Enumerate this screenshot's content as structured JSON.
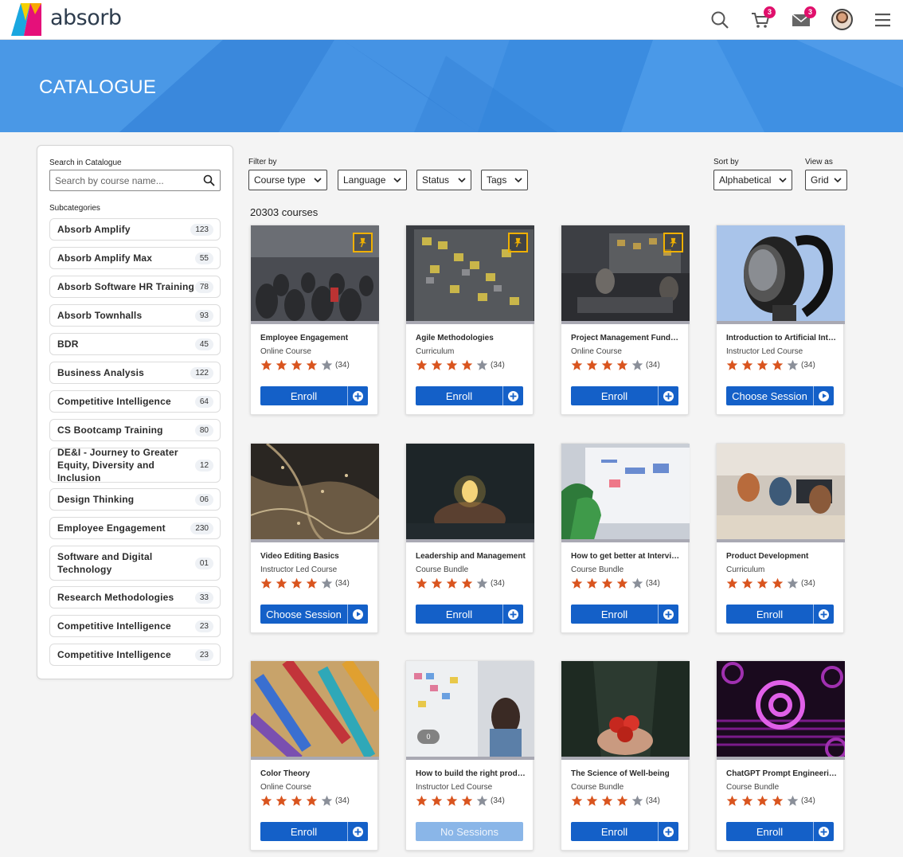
{
  "app": {
    "logo_text": "absorb"
  },
  "header": {
    "cart_badge": "3",
    "messages_badge": "3",
    "icons": [
      "search-icon",
      "cart-icon",
      "mail-icon",
      "avatar",
      "menu-icon"
    ]
  },
  "banner": {
    "title": "CATALOGUE",
    "color": "#3d8fe2"
  },
  "sidebar": {
    "search_label": "Search in Catalogue",
    "search_placeholder": "Search by course name...",
    "subcategories_label": "Subcategories",
    "items": [
      {
        "name": "Absorb Amplify",
        "count": "123"
      },
      {
        "name": "Absorb Amplify Max",
        "count": "55"
      },
      {
        "name": "Absorb Software HR Training",
        "count": "78"
      },
      {
        "name": "Absorb Townhalls",
        "count": "93"
      },
      {
        "name": "BDR",
        "count": "45"
      },
      {
        "name": "Business Analysis",
        "count": "122"
      },
      {
        "name": "Competitive Intelligence",
        "count": "64"
      },
      {
        "name": "CS Bootcamp Training",
        "count": "80"
      },
      {
        "name": "DE&I - Journey to Greater Equity, Diversity and Inclusion",
        "count": "12"
      },
      {
        "name": "Design Thinking",
        "count": "06"
      },
      {
        "name": "Employee Engagement",
        "count": "230"
      },
      {
        "name": "Software and Digital Technology",
        "count": "01"
      },
      {
        "name": "Research Methodologies",
        "count": "33"
      },
      {
        "name": "Competitive Intelligence",
        "count": "23"
      },
      {
        "name": "Competitive Intelligence",
        "count": "23"
      }
    ]
  },
  "filters": {
    "filter_by_label": "Filter by",
    "course_type": "Course type",
    "language": "Language",
    "status": "Status",
    "tags": "Tags",
    "sort_by_label": "Sort by",
    "sort_value": "Alphabetical",
    "view_as_label": "View as",
    "view_value": "Grid"
  },
  "results": {
    "count_text": "20303 courses"
  },
  "cards": [
    {
      "title": "Employee Engagement",
      "type": "Online Course",
      "rating": 4,
      "reviews": "(34)",
      "action": "Enroll",
      "pinned": true
    },
    {
      "title": "Agile Methodologies",
      "type": "Curriculum",
      "rating": 4,
      "reviews": "(34)",
      "action": "Enroll",
      "pinned": true
    },
    {
      "title": "Project Management Fundamentals",
      "type": "Online Course",
      "rating": 4,
      "reviews": "(34)",
      "action": "Enroll",
      "pinned": true
    },
    {
      "title": "Introduction to Artificial Intelligence",
      "type": "Instructor Led Course",
      "rating": 4,
      "reviews": "(34)",
      "action": "Choose Session",
      "pinned": false
    },
    {
      "title": "Video Editing Basics",
      "type": "Instructor Led Course",
      "rating": 4,
      "reviews": "(34)",
      "action": "Choose Session",
      "pinned": false
    },
    {
      "title": "Leadership and Management",
      "type": "Course Bundle",
      "rating": 4,
      "reviews": "(34)",
      "action": "Enroll",
      "pinned": false
    },
    {
      "title": "How to get better at Interviewing",
      "type": "Course Bundle",
      "rating": 4,
      "reviews": "(34)",
      "action": "Enroll",
      "pinned": false
    },
    {
      "title": "Product Development",
      "type": "Curriculum",
      "rating": 4,
      "reviews": "(34)",
      "action": "Enroll",
      "pinned": false
    },
    {
      "title": "Color Theory",
      "type": "Online Course",
      "rating": 4,
      "reviews": "(34)",
      "action": "Enroll",
      "pinned": false
    },
    {
      "title": "How to build the right product",
      "type": "Instructor Led Course",
      "rating": 4,
      "reviews": "(34)",
      "action": "No Sessions",
      "pinned": false,
      "badge": "0"
    },
    {
      "title": "The Science of Well-being",
      "type": "Course Bundle",
      "rating": 4,
      "reviews": "(34)",
      "action": "Enroll",
      "pinned": false
    },
    {
      "title": "ChatGPT Prompt Engineering",
      "type": "Course Bundle",
      "rating": 4,
      "reviews": "(34)",
      "action": "Enroll",
      "pinned": false
    }
  ],
  "colors": {
    "accent": "#1460c8",
    "star": "#d9541e",
    "badge": "#e0106c",
    "pin": "#f0b000"
  }
}
